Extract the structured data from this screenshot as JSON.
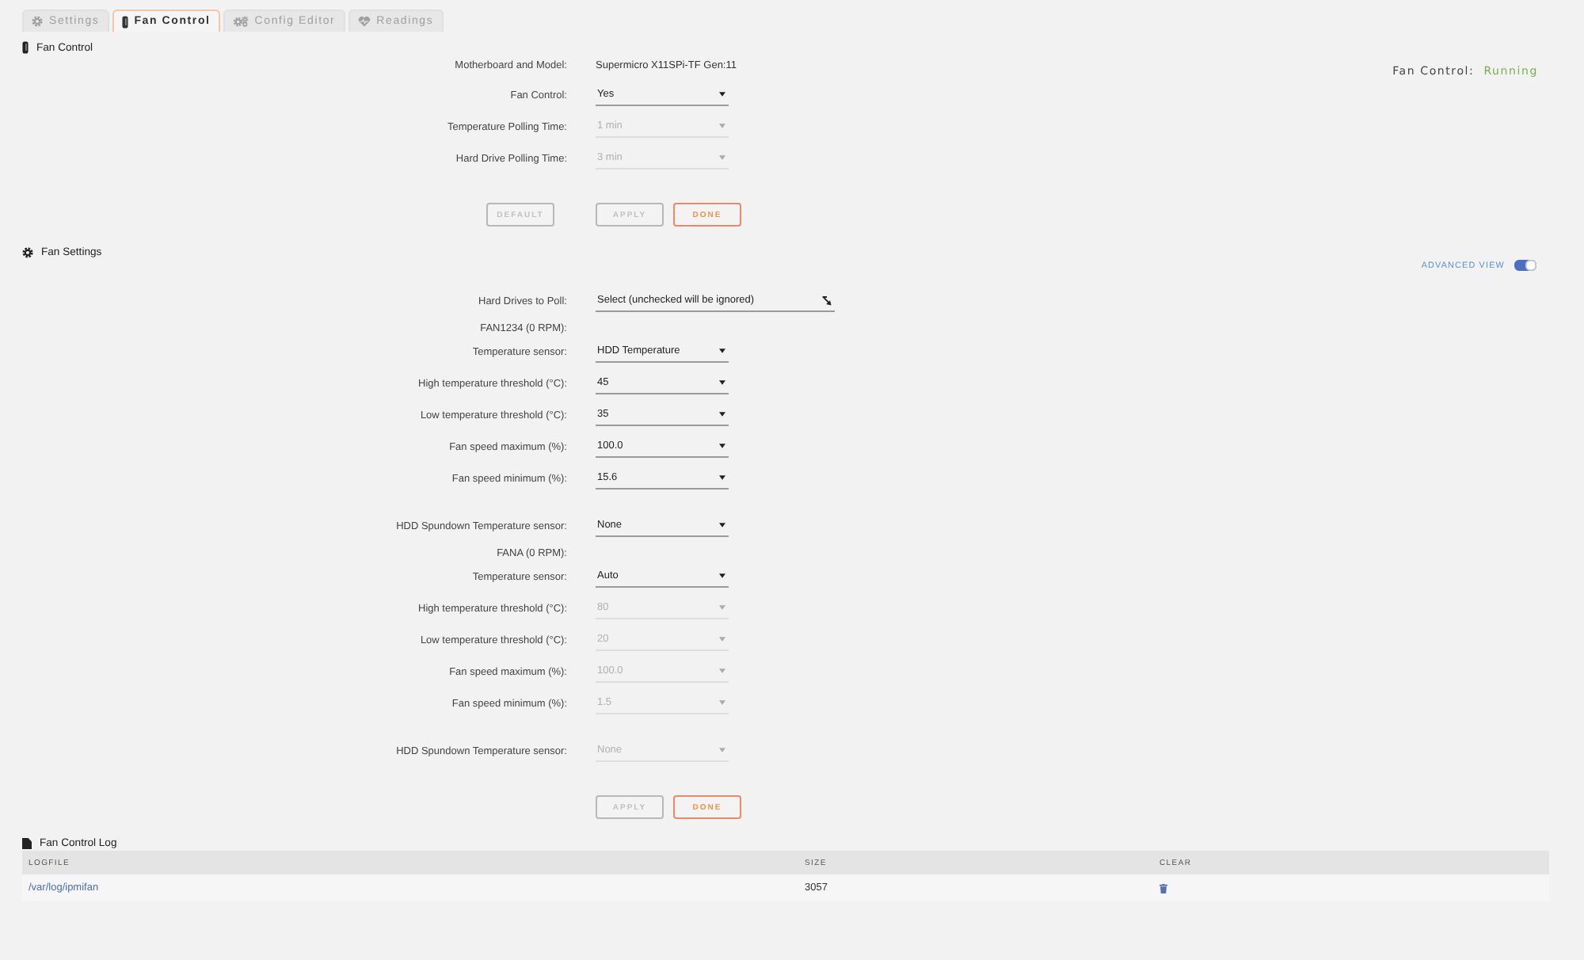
{
  "tabs": [
    {
      "label": "Settings",
      "selected": false
    },
    {
      "label": "Fan Control",
      "selected": true
    },
    {
      "label": "Config Editor",
      "selected": false
    },
    {
      "label": "Readings",
      "selected": false
    }
  ],
  "fan_control": {
    "title": "Fan Control",
    "status": {
      "label": "Fan Control:",
      "value": "Running"
    },
    "fields": [
      {
        "kind": "text",
        "label": "Motherboard and Model:",
        "value": "Supermicro X11SPi-TF Gen:11"
      },
      {
        "kind": "select",
        "label": "Fan Control:",
        "value": "Yes",
        "disabled": false
      },
      {
        "kind": "select",
        "label": "Temperature Polling Time:",
        "value": "1 min",
        "disabled": true
      },
      {
        "kind": "select",
        "label": "Hard Drive Polling Time:",
        "value": "3 min",
        "disabled": true
      }
    ],
    "buttons": [
      {
        "label": "DEFAULT",
        "kind": "reset",
        "disabled": true
      },
      {
        "label": "APPLY",
        "kind": "apply",
        "disabled": true
      },
      {
        "label": "DONE",
        "kind": "confirm",
        "disabled": false
      }
    ]
  },
  "fan_settings": {
    "title": "Fan Settings",
    "advanced_view": {
      "label": "ADVANCED VIEW",
      "on": true
    },
    "drives": {
      "label": "Hard Drives to Poll:",
      "value": "Select (unchecked will be ignored)"
    },
    "fans": [
      {
        "name": "FAN1234 (0 RPM):",
        "settings": [
          {
            "label": "Temperature sensor:",
            "value": "HDD Temperature",
            "disabled": false
          },
          {
            "label": "High temperature threshold (°C):",
            "value": "45",
            "disabled": false
          },
          {
            "label": "Low temperature threshold (°C):",
            "value": "35",
            "disabled": false
          },
          {
            "label": "Fan speed maximum (%):",
            "value": "100.0",
            "disabled": false
          },
          {
            "label": "Fan speed minimum (%):",
            "value": "15.6",
            "disabled": false
          }
        ],
        "spundown": {
          "label": "HDD Spundown Temperature sensor:",
          "value": "None",
          "disabled": false
        }
      },
      {
        "name": "FANA (0 RPM):",
        "settings": [
          {
            "label": "Temperature sensor:",
            "value": "Auto",
            "disabled": false
          },
          {
            "label": "High temperature threshold (°C):",
            "value": "80",
            "disabled": true
          },
          {
            "label": "Low temperature threshold (°C):",
            "value": "20",
            "disabled": true
          },
          {
            "label": "Fan speed maximum (%):",
            "value": "100.0",
            "disabled": true
          },
          {
            "label": "Fan speed minimum (%):",
            "value": "1.5",
            "disabled": true
          }
        ],
        "spundown": {
          "label": "HDD Spundown Temperature sensor:",
          "value": "None",
          "disabled": true
        }
      }
    ],
    "buttons": [
      {
        "label": "APPLY",
        "kind": "apply",
        "disabled": true
      },
      {
        "label": "DONE",
        "kind": "confirm",
        "disabled": false
      }
    ]
  },
  "log": {
    "title": "Fan Control Log",
    "columns": [
      "LOGFILE",
      "SIZE",
      "CLEAR"
    ],
    "rows": [
      {
        "logfile": "/var/log/ipmifan",
        "size": "3057"
      }
    ]
  }
}
